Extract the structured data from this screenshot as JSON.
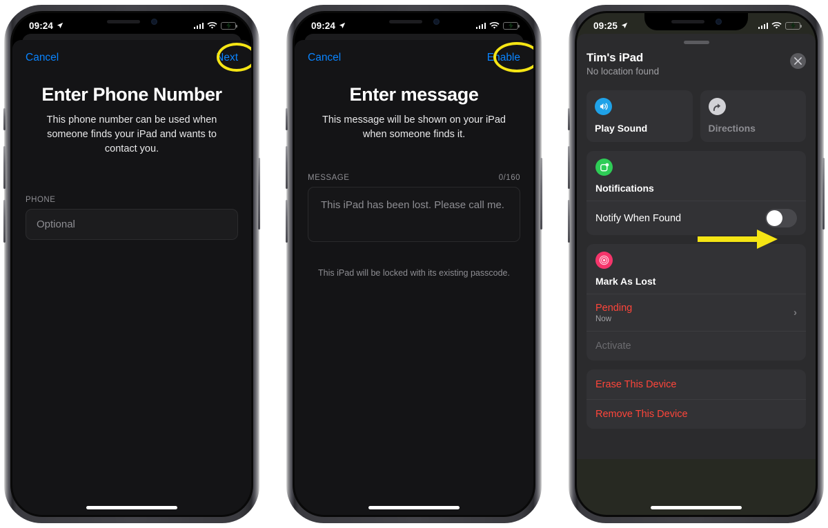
{
  "colors": {
    "accent_blue": "#0a84ff",
    "highlight_yellow": "#f5e514",
    "red": "#ff453a",
    "green": "#32d04e",
    "pink": "#f5356b"
  },
  "phones": [
    {
      "status_bar": {
        "time": "09:24",
        "location_icon": "location-arrow-icon",
        "signal_icon": "cellular-bars-icon",
        "wifi_icon": "wifi-icon",
        "battery_icon": "battery-charging-icon"
      },
      "sheet": {
        "cancel_label": "Cancel",
        "primary_label": "Next",
        "primary_highlighted": true,
        "title": "Enter Phone Number",
        "subtitle": "This phone number can be used when someone finds your iPad and wants to contact you.",
        "field_label": "PHONE",
        "field_placeholder": "Optional",
        "field_value": ""
      }
    },
    {
      "status_bar": {
        "time": "09:24",
        "location_icon": "location-arrow-icon",
        "signal_icon": "cellular-bars-icon",
        "wifi_icon": "wifi-icon",
        "battery_icon": "battery-charging-icon"
      },
      "sheet": {
        "cancel_label": "Cancel",
        "primary_label": "Enable",
        "primary_highlighted": true,
        "title": "Enter message",
        "subtitle": "This message will be shown on your iPad when someone finds it.",
        "field_label": "MESSAGE",
        "counter": "0/160",
        "field_placeholder": "This iPad has been lost. Please call me.",
        "field_value": "",
        "footnote": "This iPad will be locked with its existing passcode."
      }
    },
    {
      "status_bar": {
        "time": "09:25",
        "location_icon": "location-arrow-icon",
        "signal_icon": "cellular-bars-icon",
        "wifi_icon": "wifi-icon",
        "battery_icon": "battery-charging-icon"
      },
      "card": {
        "device_name": "Tim's iPad",
        "location_status": "No location found",
        "close_icon": "close-circle-icon",
        "actions": [
          {
            "label": "Play Sound",
            "icon": "speaker-wave-icon",
            "enabled": true
          },
          {
            "label": "Directions",
            "icon": "directions-arrow-icon",
            "enabled": false
          }
        ],
        "notifications": {
          "icon": "notifications-app-icon",
          "title": "Notifications",
          "row_label": "Notify When Found",
          "toggle_on": false,
          "annotated": true
        },
        "mark_as_lost": {
          "icon": "findmy-target-icon",
          "title": "Mark As Lost",
          "status_label": "Pending",
          "status_time": "Now",
          "chevron_icon": "chevron-right-icon",
          "activate_label": "Activate",
          "activate_enabled": false
        },
        "destructive": [
          {
            "label": "Erase This Device"
          },
          {
            "label": "Remove This Device"
          }
        ]
      }
    }
  ]
}
